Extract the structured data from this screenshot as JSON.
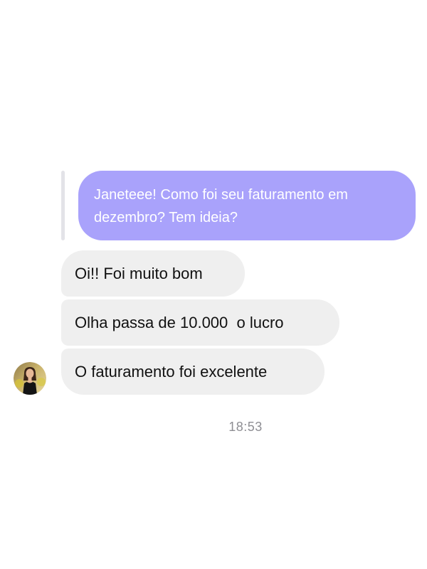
{
  "conversation": {
    "outgoing": {
      "text": "Janeteee! Como foi seu faturamento em dezembro? Tem ideia?"
    },
    "incoming": [
      {
        "text": "Oi!! Foi muito bom"
      },
      {
        "text": "Olha passa de 10.000  o lucro"
      },
      {
        "text": "O faturamento foi excelente"
      }
    ],
    "timestamp": "18:53"
  },
  "colors": {
    "outgoing_bubble": "#a9a2fb",
    "incoming_bubble": "#efefef",
    "timestamp_text": "#8e8e93"
  },
  "icons": {
    "avatar": "user-avatar-photo"
  }
}
